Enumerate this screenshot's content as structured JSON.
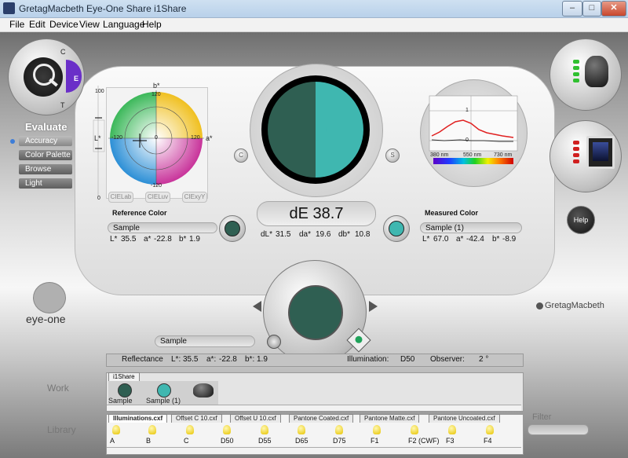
{
  "window": {
    "title": "GretagMacbeth Eye-One Share   i1Share",
    "minimize": "–",
    "maximize": "□",
    "close": "✕"
  },
  "menu": [
    "File",
    "Edit",
    "Device",
    "View",
    "Language",
    "Help"
  ],
  "sidebar": {
    "mode_letters": [
      "C",
      "E",
      "T"
    ],
    "heading": "Evaluate",
    "items": [
      "Accuracy",
      "Color Palette",
      "Browse",
      "Light"
    ]
  },
  "color_wheel": {
    "axis_b": "b*",
    "axis_a": "a*",
    "axis_l": "L*",
    "ticks": {
      "top": "120",
      "bottom": "-120",
      "left": "-120",
      "right": "120",
      "center": "0",
      "l_top": "100",
      "l_bottom": "0"
    },
    "spaces": [
      "CIELab",
      "CIELuv",
      "CIExyY"
    ]
  },
  "compare": {
    "left_button": "C",
    "right_button": "S",
    "reference_color_hex": "#2f5f52",
    "measured_color_hex": "#3fb7b0",
    "delta_e": "dE 38.7",
    "dl_label": "dL*",
    "dl": "31.5",
    "da_label": "da*",
    "da": "19.6",
    "db_label": "db*",
    "db": "10.8"
  },
  "reference": {
    "heading": "Reference Color",
    "name": "Sample",
    "L_label": "L*",
    "L": "35.5",
    "a_label": "a*",
    "a": "-22.8",
    "b_label": "b*",
    "b": "1.9"
  },
  "measured": {
    "heading": "Measured Color",
    "name": "Sample (1)",
    "L_label": "L*",
    "L": "67.0",
    "a_label": "a*",
    "a": "-42.4",
    "b_label": "b*",
    "b": "-8.9"
  },
  "spectrum": {
    "top_tick": "1",
    "zero_tick": "0",
    "ticks": [
      "380 nm",
      "550 nm",
      "730 nm"
    ]
  },
  "help_button": "Help",
  "branding": {
    "left": "eye-one",
    "right": "GretagMacbeth"
  },
  "selector": {
    "center_color_hex": "#2f5f52",
    "sample_name": "Sample"
  },
  "status": {
    "reflectance_label": "Reflectance",
    "L_label": "L*:",
    "L": "35.5",
    "a_label": "a*:",
    "a": "-22.8",
    "b_label": "b*:",
    "b": "1.9",
    "illumination_label": "Illumination:",
    "illumination": "D50",
    "observer_label": "Observer:",
    "observer": "2 °"
  },
  "work": {
    "label": "Work",
    "tab": "i1Share",
    "items": [
      {
        "name": "Sample",
        "color": "#2f5f52"
      },
      {
        "name": "Sample (1)",
        "color": "#3fb7b0"
      }
    ]
  },
  "library": {
    "label": "Library",
    "tabs": [
      "Illuminations.cxf",
      "Offset C 10.cxf",
      "Offset U 10.cxf",
      "Pantone Coated.cxf",
      "Pantone Matte.cxf",
      "Pantone Uncoated.cxf"
    ],
    "bulbs": [
      "A",
      "B",
      "C",
      "D50",
      "D55",
      "D65",
      "D75",
      "F1",
      "F2 (CWF)",
      "F3",
      "F4"
    ]
  },
  "filter_label": "Filter"
}
